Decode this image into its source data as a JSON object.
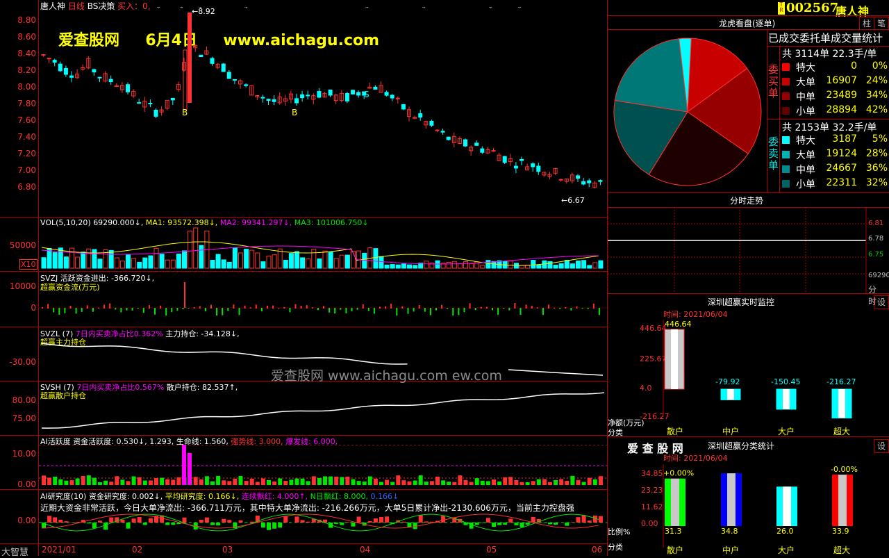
{
  "header": {
    "stock_name": "唐人神",
    "period": "日线",
    "strategy": "BS决策",
    "signal": "买入：0,",
    "high_mark": "8.92",
    "low_mark": "6.67",
    "right_code": "002567",
    "right_name": "唐人神",
    "badge": "TR"
  },
  "watermark": {
    "brand": "爱查股网",
    "date": "6月4日",
    "url": "www.aichagu.com",
    "center": "爱查股网    www.aichagu.com    ew.com"
  },
  "price_axis": [
    "8.80",
    "8.60",
    "8.40",
    "8.20",
    "8.00",
    "7.80",
    "7.60",
    "7.40",
    "7.20",
    "7.00",
    "6.80"
  ],
  "vol_panel": {
    "title": "VOL(5,10,20)",
    "v0": "69290.000↓,",
    "ma1": "MA1: 93572.398↓,",
    "ma2": "MA2: 99341.297↓,",
    "ma3": "MA3: 101006.750↓",
    "axis": "50000",
    "unit": "X10"
  },
  "svzj": {
    "title": "SVZJ",
    "text": "活跃资金进出: -366.720↓,",
    "sub": "超赢资金流(万元)",
    "axis": [
      "10000",
      "0"
    ]
  },
  "svzl": {
    "title": "SVZL (7)",
    "ratio": "7日内买卖净占比0.362%",
    "main": "主力持仓: -34.128↓,",
    "sub": "超赢主力持仓",
    "axis": "-30.00"
  },
  "svsh": {
    "title": "SVSH (7)",
    "ratio": "7日内买卖净占比0.567%",
    "main": "散户持仓: 82.537↑,",
    "sub": "超赢散户持仓",
    "axis": [
      "80.00",
      "75.00"
    ]
  },
  "ai_active": {
    "title": "AI活跃度",
    "a": "资金活跃度: 0.530↓,",
    "b": "1.293,",
    "c": "生命线: 1.560,",
    "d": "强势线: 3.000,",
    "e": "爆发线: 6.000,",
    "axis": [
      "10.00",
      "0.00"
    ]
  },
  "ai_research": {
    "title": "AI研究度(10)",
    "a": "资金研究度: 0.002↓,",
    "b": "平均研究度: 0.166↓,",
    "c": "连续飘红: 4.000↑,",
    "d": "N日飘红: 8.000,",
    "e": "0.166↓",
    "comment": "近期大资金非常活跃，今日大单净流出: -366.711万元，其中特大单净流出: -216.266万元，大单5日累计净出-2130.606万元，当前主力控盘强",
    "axis": "0.00"
  },
  "bottom": {
    "corner": "大智慧",
    "months": [
      "2021/01",
      "02",
      "03",
      "04",
      "05",
      "06"
    ]
  },
  "dragon": {
    "title": "龙虎看盘(逐单)",
    "btn1": "柱",
    "btn2": "笔",
    "subtitle": "已成交委托单成交量统计",
    "buy_label": "委买单",
    "sell_label": "委卖单",
    "buy_total": "共 3114单 22.3手/单",
    "sell_total": "共 2153单 32.2手/单",
    "buy_rows": [
      {
        "name": "特大",
        "v": "0",
        "p": "0%",
        "color": "#ff0000"
      },
      {
        "name": "大单",
        "v": "16907",
        "p": "24%",
        "color": "#c80000"
      },
      {
        "name": "中单",
        "v": "23489",
        "p": "34%",
        "color": "#960000"
      },
      {
        "name": "小单",
        "v": "28894",
        "p": "42%",
        "color": "#640000"
      }
    ],
    "sell_rows": [
      {
        "name": "特大",
        "v": "3187",
        "p": "5%",
        "color": "#00ffff"
      },
      {
        "name": "大单",
        "v": "19124",
        "p": "28%",
        "color": "#00b4b4"
      },
      {
        "name": "中单",
        "v": "24667",
        "p": "36%",
        "color": "#008c8c"
      },
      {
        "name": "小单",
        "v": "22311",
        "p": "32%",
        "color": "#006464"
      }
    ]
  },
  "fenshi": {
    "title": "分时走势",
    "axis": [
      "6.81",
      "6.78",
      "6.75",
      "69290"
    ],
    "footer": "分时"
  },
  "monitor": {
    "title": "深圳超赢实时监控",
    "btn": "设",
    "time": "时间: 2021/06/04",
    "axis": [
      "446.64",
      "225.67",
      "4.0",
      "-216.27"
    ],
    "unit": "净额(万元)",
    "cat_label": "分类",
    "bars": [
      {
        "cat": "散户",
        "val": 446.64,
        "label": "446.64"
      },
      {
        "cat": "中户",
        "val": -79.92,
        "label": "-79.92"
      },
      {
        "cat": "大户",
        "val": -150.45,
        "label": "-150.45"
      },
      {
        "cat": "超大",
        "val": -216.27,
        "label": "-216.27"
      }
    ]
  },
  "classify": {
    "brand": "爱 查 股 网",
    "title": "深圳超赢分类统计",
    "btn": "设",
    "time": "时间: 2021/06/04",
    "axis": [
      "34.85",
      "23.23",
      "11.62",
      "0.00"
    ],
    "pct_label": "比例%",
    "cat_label": "分类",
    "top_labels": [
      "+0.00%",
      "",
      "",
      "-0.00%"
    ],
    "bars": [
      {
        "cat": "散户",
        "val": 31.3,
        "label": "31.3",
        "color": "#00ff00"
      },
      {
        "cat": "中户",
        "val": 34.8,
        "label": "34.8",
        "color": "#0000ff"
      },
      {
        "cat": "大户",
        "val": 26.0,
        "label": "26.0",
        "color": "#00ffff"
      },
      {
        "cat": "超大",
        "val": 33.9,
        "label": "33.9",
        "color": "#ff0000"
      }
    ]
  },
  "chart_data": {
    "type": "pie",
    "title": "已成交委托单成交量统计",
    "series": [
      {
        "name": "委买单",
        "labels": [
          "特大",
          "大单",
          "中单",
          "小单"
        ],
        "values": [
          0,
          16907,
          23489,
          28894
        ]
      },
      {
        "name": "委卖单",
        "labels": [
          "特大",
          "大单",
          "中单",
          "小单"
        ],
        "values": [
          3187,
          19124,
          24667,
          22311
        ]
      }
    ]
  }
}
